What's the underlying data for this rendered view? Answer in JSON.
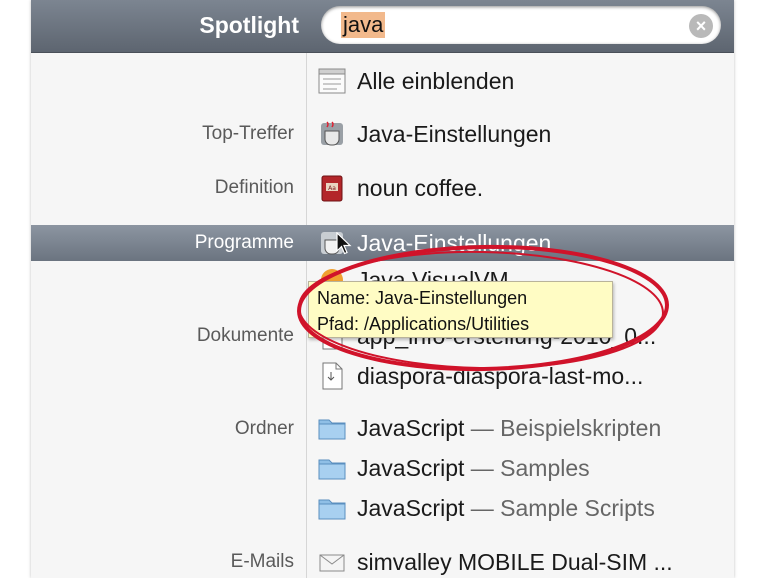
{
  "header": {
    "title": "Spotlight",
    "search_value": "java",
    "clear_icon": "clear-circle-icon"
  },
  "categories": {
    "top_hit": "Top-Treffer",
    "definition": "Definition",
    "applications": "Programme",
    "documents": "Dokumente",
    "folders": "Ordner",
    "emails": "E-Mails"
  },
  "rows": {
    "show_all": "Alle einblenden",
    "top_hit": "Java-Einstellungen",
    "definition": "noun  coffee.",
    "app_selected": "Java-Einstellungen",
    "app_second": "Java VisualVM",
    "doc1": "app_info-erstellung-2010_0...",
    "doc2": "diaspora-diaspora-last-mo...",
    "folder1_name": "JavaScript",
    "folder1_sub": " — Beispielskripten",
    "folder2_name": "JavaScript",
    "folder2_sub": " — Samples",
    "folder3_name": "JavaScript",
    "folder3_sub": " — Sample Scripts",
    "email1": "simvalley MOBILE Dual-SIM ..."
  },
  "tooltip": {
    "line1": "Name: Java-Einstellungen",
    "line2": "Pfad: /Applications/Utilities"
  },
  "colors": {
    "header": "#656d78",
    "selection": "#7a838f",
    "tooltip": "#fffcc4",
    "annotation": "#d0132a",
    "search_highlight": "#f2b98c"
  }
}
